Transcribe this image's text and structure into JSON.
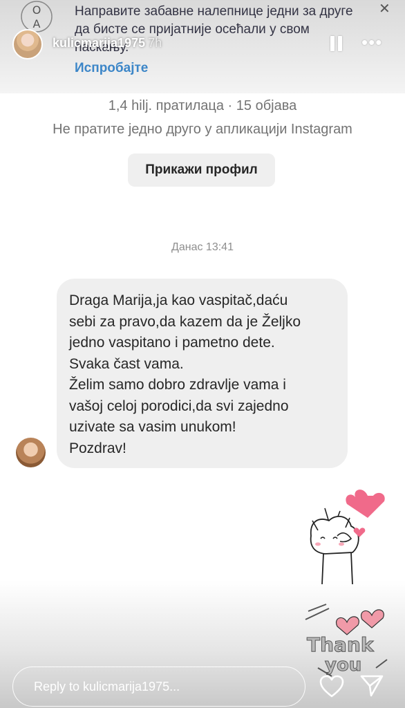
{
  "banner": {
    "logo_text": "Ō\nA",
    "text": "Направите забавне налепнице једни за друге да бисте се пријатније осећали у свом ћаскању.",
    "cta": "Испробајте",
    "close": "✕"
  },
  "header": {
    "username": "kulicmarija1975",
    "time": "7h",
    "pause_icon": "pause-icon",
    "more_icon": "more-icon",
    "more_glyph": "•••"
  },
  "profile": {
    "stats": "1,4 hilj. пратилаца · 15 објава",
    "mutual": "Не пратите једно друго у апликацији Instagram",
    "view_profile_label": "Прикажи профил"
  },
  "chat": {
    "date": "Данас 13:41",
    "message": "Draga Marija,ja kao vaspitač,daću\nsebi za pravo,da kazem da je Željko\njedno vaspitano i pametno dete.\nSvaka čast vama.\nŽelim samo dobro zdravlje vama i\nvašoj celoj porodici,da svi zajedno\nuzivate sa vasim unukom!\nPozdrav!"
  },
  "stickers": {
    "thanks_line1": "Thank",
    "thanks_line2": "you"
  },
  "footer": {
    "reply_placeholder": "Reply to kulicmarija1975...",
    "like_icon": "heart-outline-icon",
    "send_icon": "send-icon"
  },
  "colors": {
    "accent": "#3c86c8",
    "heart": "#f06a8a",
    "bubble": "#efefef"
  }
}
